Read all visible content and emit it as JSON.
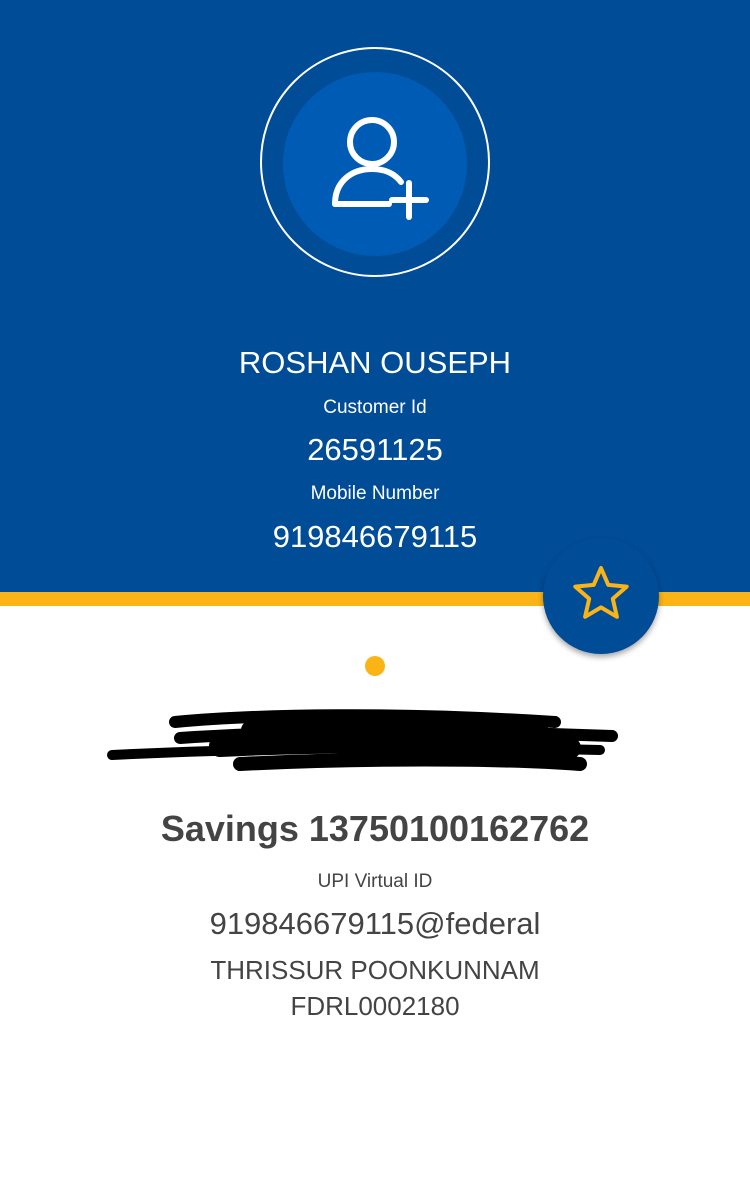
{
  "profile": {
    "name": "ROSHAN OUSEPH",
    "customer_id_label": "Customer Id",
    "customer_id": "26591125",
    "mobile_label": "Mobile Number",
    "mobile_number": "919846679115",
    "avatar_icon": "add-user-icon"
  },
  "favorite": {
    "icon": "star-icon"
  },
  "account": {
    "holder_name": "[redacted]",
    "type_and_number": "Savings 13750100162762",
    "upi_label": "UPI Virtual ID",
    "upi_id": "919846679115@federal",
    "branch": "THRISSUR POONKUNNAM",
    "ifsc": "FDRL0002180"
  },
  "colors": {
    "primary_blue": "#004c97",
    "accent_yellow": "#fbb415",
    "text_dark": "#444444"
  }
}
